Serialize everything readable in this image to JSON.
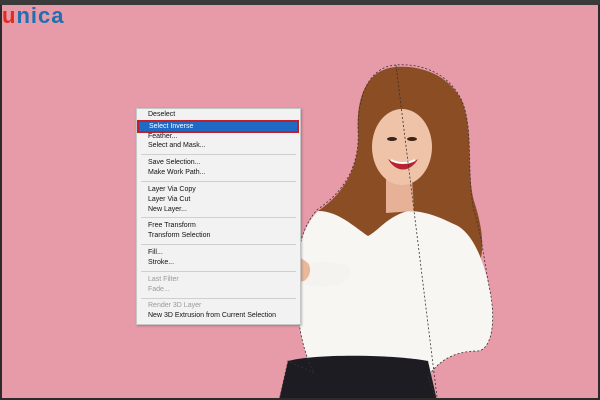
{
  "logo": {
    "first_letter": "u",
    "rest": "nica"
  },
  "colors": {
    "canvas": "#e79aa8",
    "highlight": "#1f6ac4",
    "highlight_border": "#c11f2a"
  },
  "menu": {
    "items": [
      {
        "label": "Deselect"
      },
      {
        "label": "Select Inverse",
        "highlighted": true
      },
      {
        "label": "Feather..."
      },
      {
        "label": "Select and Mask..."
      },
      {
        "label": "Save Selection..."
      },
      {
        "label": "Make Work Path..."
      },
      {
        "label": "Layer Via Copy"
      },
      {
        "label": "Layer Via Cut"
      },
      {
        "label": "New Layer..."
      },
      {
        "label": "Free Transform"
      },
      {
        "label": "Transform Selection"
      },
      {
        "label": "Fill..."
      },
      {
        "label": "Stroke..."
      },
      {
        "label": "Last Filter",
        "disabled": true
      },
      {
        "label": "Fade...",
        "disabled": true
      },
      {
        "label": "Render 3D Layer",
        "disabled": true
      },
      {
        "label": "New 3D Extrusion from Current Selection"
      }
    ]
  }
}
